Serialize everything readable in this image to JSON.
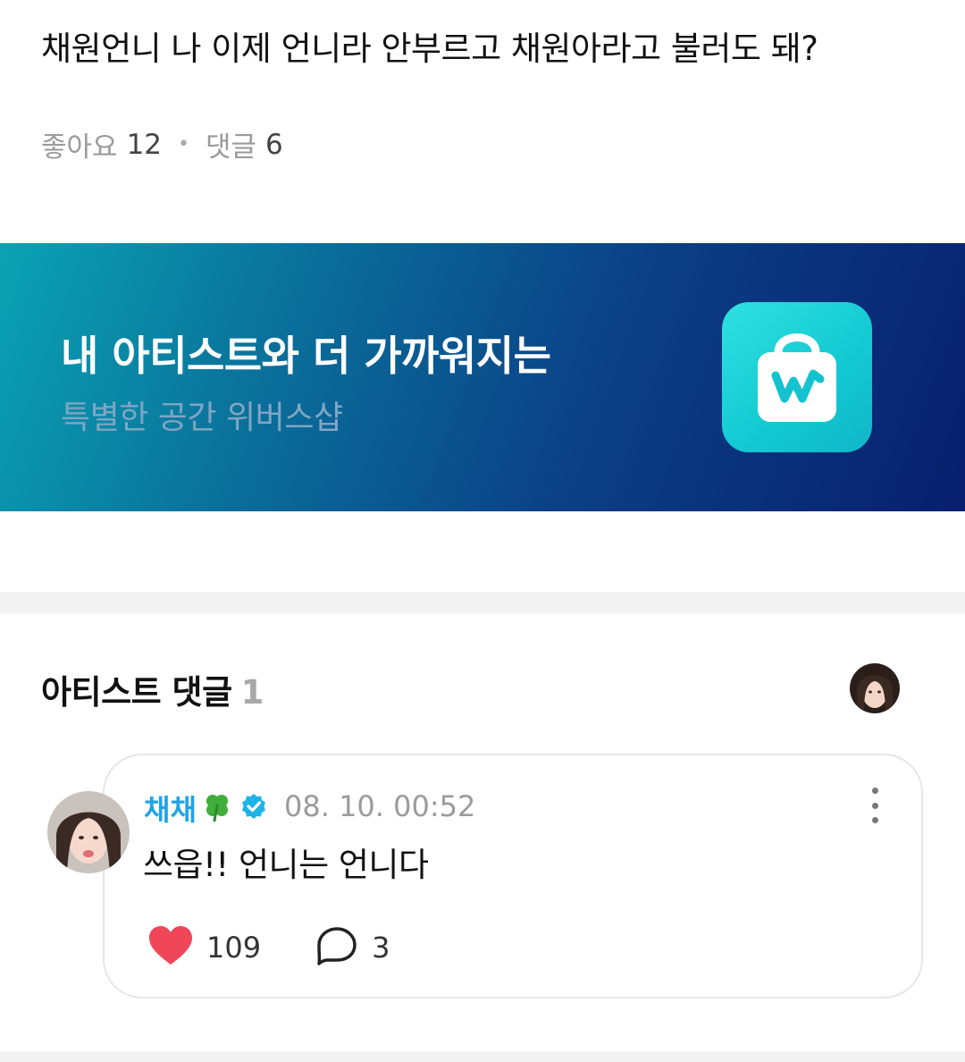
{
  "post": {
    "text": "채원언니 나 이제 언니라 안부르고 채원아라고 불러도 돼?",
    "likes_label": "좋아요",
    "likes_count": "12",
    "comments_label": "댓글",
    "comments_count": "6"
  },
  "banner": {
    "title": "내 아티스트와 더 가까워지는",
    "subtitle": "특별한 공간 위버스샵",
    "icon": "weverse-shop-bag-icon"
  },
  "artist_comments": {
    "title": "아티스트 댓글",
    "count": "1",
    "comment": {
      "author": "채채",
      "author_emoji": "🍀",
      "verified_icon": "verified-badge-icon",
      "timestamp": "08. 10. 00:52",
      "text": "쓰읍!! 언니는 언니다",
      "likes": "109",
      "replies": "3"
    }
  },
  "colors": {
    "author_name": "#1fa3e8",
    "like_heart": "#f0465a",
    "banner_start": "#0aa3b3",
    "banner_end": "#081f6e",
    "shop_tile": "#14cbd4"
  }
}
